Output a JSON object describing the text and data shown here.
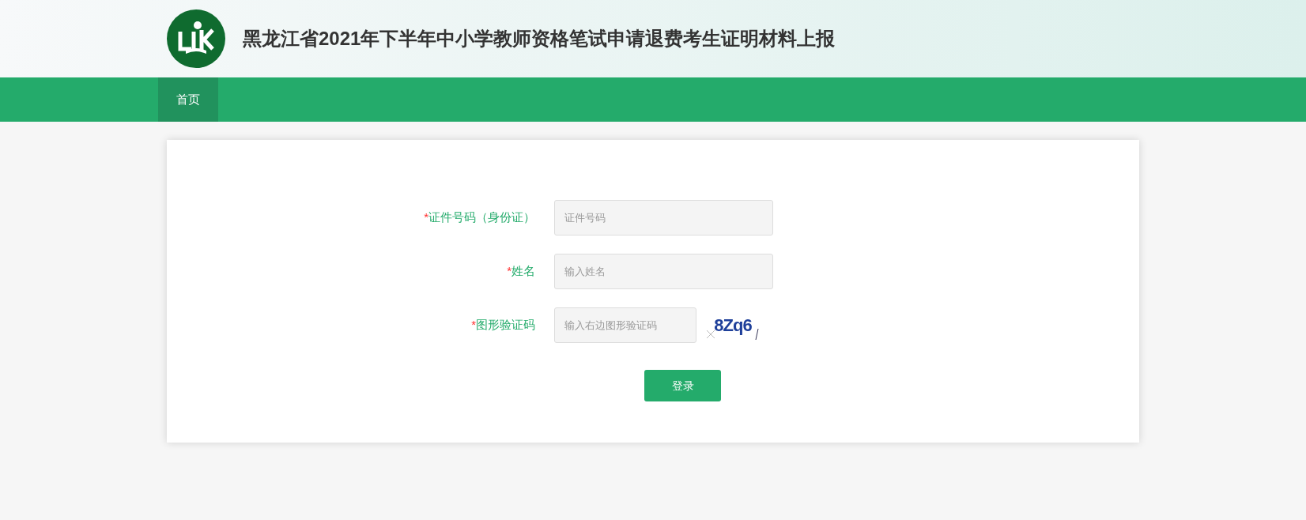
{
  "header": {
    "title": "黑龙江省2021年下半年中小学教师资格笔试申请退费考生证明材料上报"
  },
  "nav": [
    {
      "label": "首页",
      "selected": true
    }
  ],
  "form": {
    "fields": [
      {
        "mark": "*",
        "label": "证件号码（身份证）",
        "placeholder": "证件号码",
        "kind": "text"
      },
      {
        "mark": "*",
        "label": "姓名",
        "placeholder": "输入姓名",
        "kind": "text"
      },
      {
        "mark": "*",
        "label": "图形验证码",
        "placeholder": "输入右边图形验证码",
        "kind": "captcha",
        "captcha": "8Zq6"
      }
    ],
    "submit": "登录"
  }
}
